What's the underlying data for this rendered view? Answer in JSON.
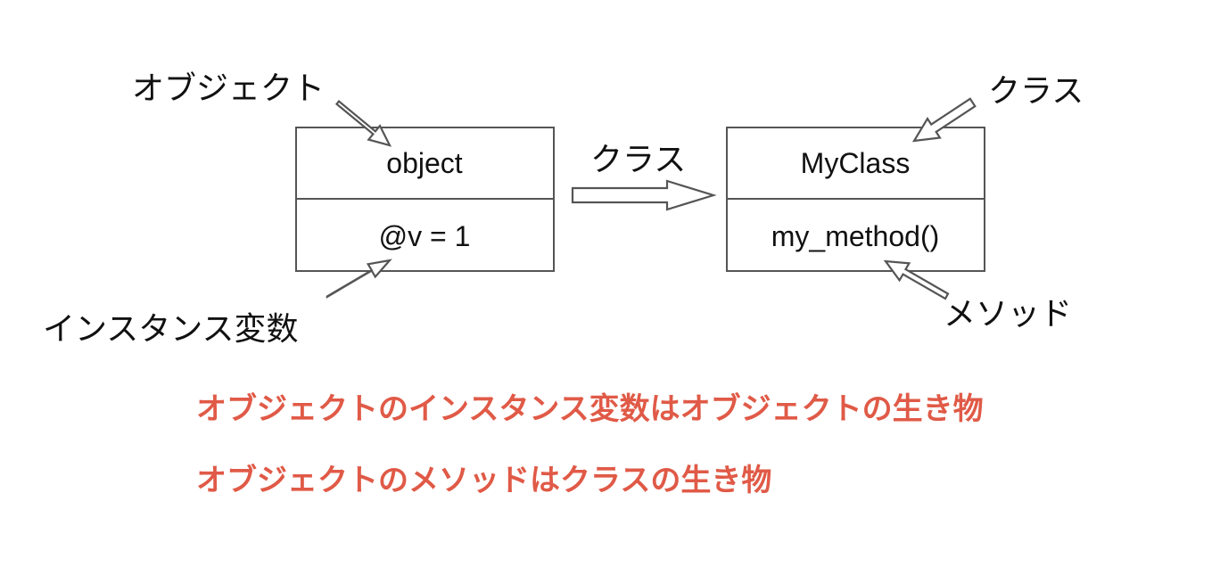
{
  "object_box": {
    "header": "object",
    "body": "@v = 1"
  },
  "class_box": {
    "header": "MyClass",
    "body": "my_method()"
  },
  "labels": {
    "object_label": "オブジェクト",
    "instance_var_label": "インスタンス変数",
    "class_arrow_label": "クラス",
    "class_label": "クラス",
    "method_label": "メソッド"
  },
  "notes": [
    "オブジェクトのインスタンス変数はオブジェクトの生き物",
    "オブジェクトのメソッドはクラスの生き物"
  ],
  "colors": {
    "note_text": "#e05a47",
    "outline": "#555555",
    "text": "#111111"
  }
}
